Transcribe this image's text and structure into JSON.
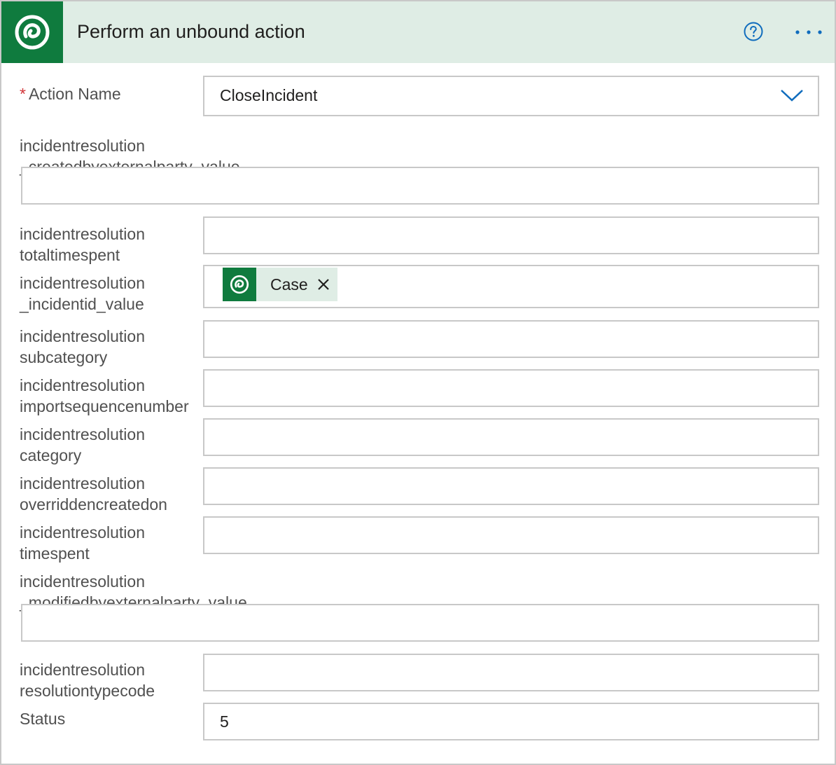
{
  "header": {
    "title": "Perform an unbound action",
    "logo_icon": "dataverse-logo-icon",
    "help_icon": "help-circle-icon",
    "more_icon": "more-ellipsis-icon",
    "colors": {
      "header_bg": "#dfede5",
      "logo_bg": "#0f7b3e",
      "accent": "#0f6cbd"
    }
  },
  "action_name": {
    "required_marker": "*",
    "label": "Action Name",
    "value": "CloseIncident"
  },
  "fields": {
    "createdbyexternalparty": {
      "label_line1": "incidentresolution",
      "label_line2": "_createdbyexternalparty_value",
      "value": ""
    },
    "totaltimespent": {
      "label_line1": "incidentresolution",
      "label_line2": "totaltimespent",
      "value": ""
    },
    "incidentid": {
      "label_line1": "incidentresolution",
      "label_line2": "_incidentid_value",
      "token_label": "Case"
    },
    "subcategory": {
      "label_line1": "incidentresolution",
      "label_line2": "subcategory",
      "value": ""
    },
    "importsequencenumber": {
      "label_line1": "incidentresolution",
      "label_line2": "importsequencenumber",
      "value": ""
    },
    "category": {
      "label_line1": "incidentresolution",
      "label_line2": "category",
      "value": ""
    },
    "overriddencreatedon": {
      "label_line1": "incidentresolution",
      "label_line2": "overriddencreatedon",
      "value": ""
    },
    "timespent": {
      "label_line1": "incidentresolution",
      "label_line2": "timespent",
      "value": ""
    },
    "modifiedbyexternalparty": {
      "label_line1": "incidentresolution",
      "label_line2": "_modifiedbyexternalparty_value",
      "value": ""
    },
    "resolutiontypecode": {
      "label_line1": "incidentresolution",
      "label_line2": "resolutiontypecode",
      "value": ""
    },
    "status": {
      "label": "Status",
      "value": "5"
    }
  }
}
